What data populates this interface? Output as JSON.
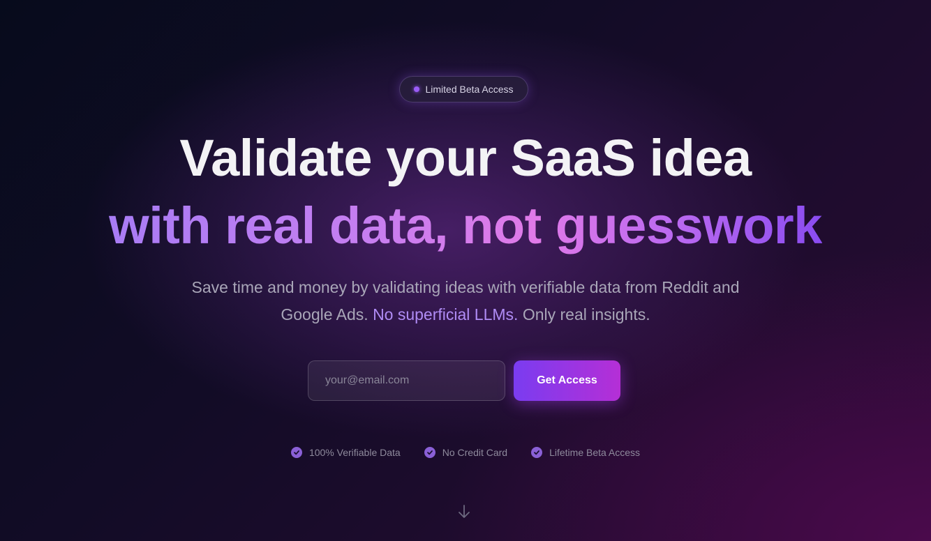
{
  "badge": {
    "label": "Limited Beta Access"
  },
  "hero": {
    "title_line1": "Validate your SaaS idea",
    "title_line2": "with real data, not guesswork"
  },
  "subtitle": {
    "part1": "Save time and money by validating ideas with verifiable data from Reddit and Google Ads.",
    "highlight": "No superficial LLMs.",
    "part2": "Only real insights."
  },
  "signup": {
    "email_placeholder": "your@email.com",
    "email_value": "",
    "button_label": "Get Access"
  },
  "features": [
    {
      "label": "100% Verifiable Data",
      "icon": "check-circle-icon"
    },
    {
      "label": "No Credit Card",
      "icon": "check-circle-icon"
    },
    {
      "label": "Lifetime Beta Access",
      "icon": "check-circle-icon"
    }
  ],
  "scroll_indicator": {
    "icon": "arrow-down-icon"
  },
  "colors": {
    "accent_purple": "#9a5cf6",
    "button_gradient_start": "#7a3cf0",
    "button_gradient_end": "#b52fd6",
    "highlight_text": "#b08cf5"
  }
}
